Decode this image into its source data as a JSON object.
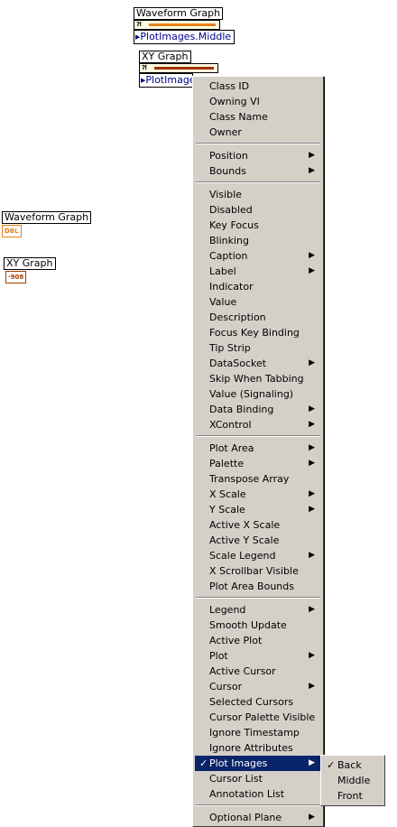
{
  "nodes": {
    "waveform_top": {
      "label": "Waveform Graph",
      "property": "PlotImages.Middle",
      "strip_color": "#e8801a"
    },
    "xy_top": {
      "label": "XY Graph",
      "property": "PlotImages",
      "strip_color": "#a03000"
    },
    "waveform_term": {
      "label": "Waveform Graph",
      "type": "DBL",
      "color": "#e8801a"
    },
    "xy_term": {
      "label": "XY Graph",
      "type": "·908",
      "color": "#a04000"
    }
  },
  "menu": {
    "groups": [
      [
        {
          "label": "Class ID"
        },
        {
          "label": "Owning VI"
        },
        {
          "label": "Class Name"
        },
        {
          "label": "Owner"
        }
      ],
      [
        {
          "label": "Position",
          "submenu": true
        },
        {
          "label": "Bounds",
          "submenu": true
        }
      ],
      [
        {
          "label": "Visible"
        },
        {
          "label": "Disabled"
        },
        {
          "label": "Key Focus"
        },
        {
          "label": "Blinking"
        },
        {
          "label": "Caption",
          "submenu": true
        },
        {
          "label": "Label",
          "submenu": true
        },
        {
          "label": "Indicator"
        },
        {
          "label": "Value"
        },
        {
          "label": "Description"
        },
        {
          "label": "Focus Key Binding"
        },
        {
          "label": "Tip Strip"
        },
        {
          "label": "DataSocket",
          "submenu": true
        },
        {
          "label": "Skip When Tabbing"
        },
        {
          "label": "Value (Signaling)"
        },
        {
          "label": "Data Binding",
          "submenu": true
        },
        {
          "label": "XControl",
          "submenu": true
        }
      ],
      [
        {
          "label": "Plot Area",
          "submenu": true
        },
        {
          "label": "Palette",
          "submenu": true
        },
        {
          "label": "Transpose Array"
        },
        {
          "label": "X Scale",
          "submenu": true
        },
        {
          "label": "Y Scale",
          "submenu": true
        },
        {
          "label": "Active X Scale"
        },
        {
          "label": "Active Y Scale"
        },
        {
          "label": "Scale Legend",
          "submenu": true
        },
        {
          "label": "X Scrollbar Visible"
        },
        {
          "label": "Plot Area Bounds"
        }
      ],
      [
        {
          "label": "Legend",
          "submenu": true
        },
        {
          "label": "Smooth Update"
        },
        {
          "label": "Active Plot"
        },
        {
          "label": "Plot",
          "submenu": true
        },
        {
          "label": "Active Cursor"
        },
        {
          "label": "Cursor",
          "submenu": true
        },
        {
          "label": "Selected Cursors"
        },
        {
          "label": "Cursor Palette Visible"
        },
        {
          "label": "Ignore Timestamp"
        },
        {
          "label": "Ignore Attributes"
        },
        {
          "label": "Plot Images",
          "submenu": true,
          "checked": true,
          "selected": true
        },
        {
          "label": "Cursor List"
        },
        {
          "label": "Annotation List"
        }
      ],
      [
        {
          "label": "Optional Plane",
          "submenu": true
        }
      ]
    ],
    "submenu_arrow": "▶",
    "check_mark": "✓"
  },
  "plot_images_submenu": {
    "items": [
      {
        "label": "Back",
        "checked": true
      },
      {
        "label": "Middle"
      },
      {
        "label": "Front"
      }
    ]
  }
}
